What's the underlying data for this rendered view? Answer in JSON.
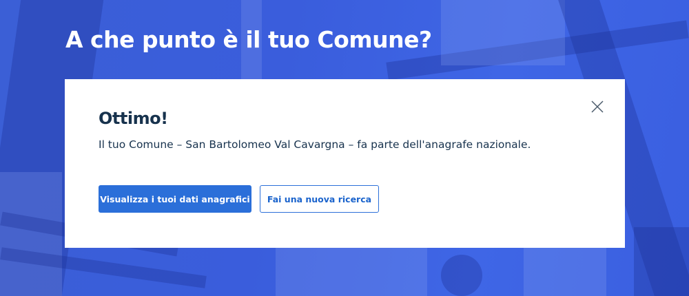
{
  "hero": {
    "title": "A che punto è il tuo Comune?"
  },
  "result_card": {
    "title": "Ottimo!",
    "message": "Il tuo Comune – San Bartolomeo Val Cavargna – fa parte dell'anagrafe nazionale.",
    "primary_button_label": "Visualizza i tuoi dati anagrafici",
    "secondary_button_label": "Fai una nuova ricerca",
    "close_icon": "close-icon"
  },
  "colors": {
    "background_overlay": "#3b5fd6",
    "primary": "#2b6fd9",
    "text_dark": "#17324d",
    "card_background": "#ffffff"
  }
}
